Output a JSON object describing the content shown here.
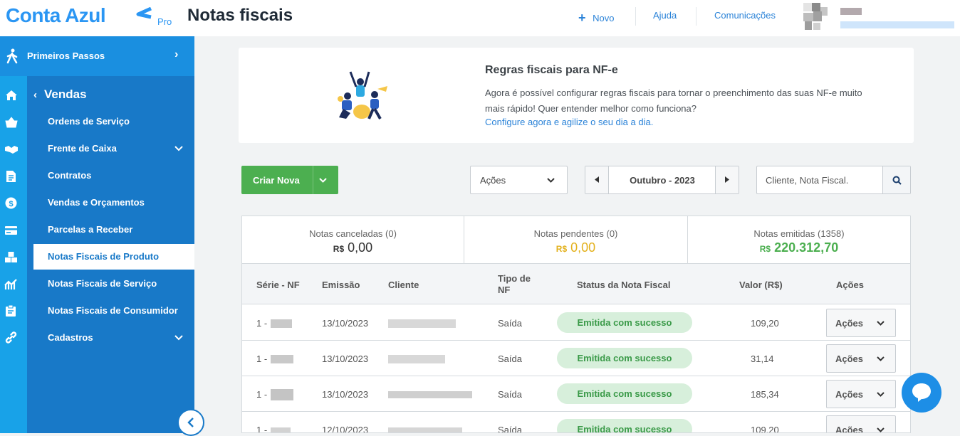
{
  "brand": {
    "name": "Conta Azul",
    "tier": "Pro"
  },
  "header": {
    "page_title": "Notas fiscais",
    "new_label": "Novo",
    "help_label": "Ajuda",
    "comms_label": "Comunicações"
  },
  "sidebar": {
    "first_steps": "Primeiros Passos",
    "section": "Vendas",
    "items": [
      {
        "label": "Ordens de Serviço",
        "has_submenu": false
      },
      {
        "label": "Frente de Caixa",
        "has_submenu": true
      },
      {
        "label": "Contratos",
        "has_submenu": false
      },
      {
        "label": "Vendas e Orçamentos",
        "has_submenu": false
      },
      {
        "label": "Parcelas a Receber",
        "has_submenu": false
      },
      {
        "label": "Notas Fiscais de Produto",
        "has_submenu": false,
        "active": true
      },
      {
        "label": "Notas Fiscais de Serviço",
        "has_submenu": false
      },
      {
        "label": "Notas Fiscais de Consumidor",
        "has_submenu": false
      },
      {
        "label": "Cadastros",
        "has_submenu": true
      }
    ],
    "icons": [
      "walk-icon",
      "home-icon",
      "basket-icon",
      "handshake-icon",
      "document-icon",
      "dollar-icon",
      "card-icon",
      "boxes-icon",
      "chart-icon",
      "clipboard-icon",
      "link-icon"
    ]
  },
  "banner": {
    "title": "Regras fiscais para NF-e",
    "text": "Agora é possível configurar regras fiscais para tornar o preenchimento das suas NF-e muito mais rápido! Quer entender melhor como funciona?",
    "link": "Configure agora e agilize o seu dia a dia."
  },
  "toolbar": {
    "create_label": "Criar Nova",
    "actions_label": "Ações",
    "period": "Outubro - 2023",
    "search_placeholder": "Cliente, Nota Fiscal."
  },
  "summary": [
    {
      "label": "Notas canceladas (0)",
      "currency": "R$",
      "value": "0,00",
      "color": "#333333"
    },
    {
      "label": "Notas pendentes (0)",
      "currency": "R$",
      "value": "0,00",
      "color": "#e3b11d"
    },
    {
      "label": "Notas emitidas (1358)",
      "currency": "R$",
      "value": "220.312,70",
      "color": "#4caf50"
    }
  ],
  "table": {
    "columns": [
      "Série - NF",
      "Emissão",
      "Cliente",
      "Tipo de NF",
      "Status da Nota Fiscal",
      "Valor (R$)",
      "Ações"
    ],
    "rows": [
      {
        "serie": "1 -",
        "emissao": "13/10/2023",
        "tipo": "Saída",
        "status": "Emitida com sucesso",
        "valor": "109,20",
        "acao": "Ações"
      },
      {
        "serie": "1 -",
        "emissao": "13/10/2023",
        "tipo": "Saída",
        "status": "Emitida com sucesso",
        "valor": "31,14",
        "acao": "Ações"
      },
      {
        "serie": "1 -",
        "emissao": "13/10/2023",
        "tipo": "Saída",
        "status": "Emitida com sucesso",
        "valor": "185,34",
        "acao": "Ações"
      },
      {
        "serie": "1 -",
        "emissao": "12/10/2023",
        "tipo": "Saída",
        "status": "Emitida com sucesso",
        "valor": "109,20",
        "acao": "Ações"
      }
    ]
  },
  "colors": {
    "primary": "#2b96f3",
    "sidebar": "#1879c8",
    "sidebar_light": "#18a2e8",
    "success": "#4caf50"
  }
}
